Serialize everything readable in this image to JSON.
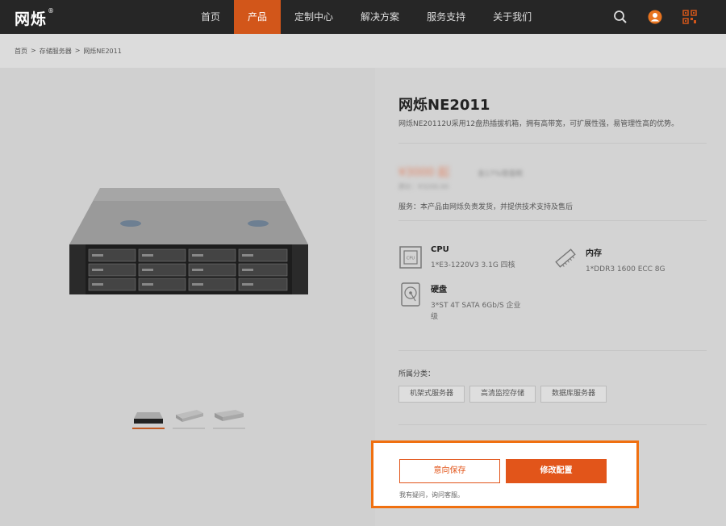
{
  "brand": {
    "name": "网烁",
    "mark": "®"
  },
  "nav": {
    "items": [
      {
        "label": "首页"
      },
      {
        "label": "产品",
        "active": true
      },
      {
        "label": "定制中心"
      },
      {
        "label": "解决方案"
      },
      {
        "label": "服务支持"
      },
      {
        "label": "关于我们"
      }
    ],
    "icons": [
      "search-icon",
      "user-icon",
      "qr-code-icon"
    ]
  },
  "breadcrumb": {
    "items": [
      "首页",
      "存储服务器",
      "网烁NE2011"
    ],
    "separator": ">"
  },
  "product": {
    "title": "网烁NE2011",
    "subtitle": "网烁NE20112U采用12盘热插拔机箱，拥有高带宽，可扩展性强，易管理性高的优势。",
    "price": "¥3000 起",
    "price_sub": "含17%增值税",
    "price_note": "原价：¥3200.00",
    "service": "服务：本产品由网烁负责发货，并提供技术支持及售后"
  },
  "specs": {
    "cpu": {
      "label": "CPU",
      "value": "1*E3-1220V3 3.1G 四核"
    },
    "memory": {
      "label": "内存",
      "value": "1*DDR3 1600 ECC 8G"
    },
    "disk": {
      "label": "硬盘",
      "value_line1": "3*ST 4T SATA 6Gb/S 企业",
      "value_line2": "级"
    }
  },
  "categories": {
    "label": "所属分类：",
    "tags": [
      "机架式服务器",
      "高清监控存储",
      "数据库服务器"
    ]
  },
  "cta": {
    "save_label": "意向保存",
    "config_label": "修改配置",
    "note": "我有疑问，询问客服。"
  },
  "colors": {
    "accent": "#e2551a",
    "highlight_border": "#f07010",
    "topbar": "#262626"
  }
}
